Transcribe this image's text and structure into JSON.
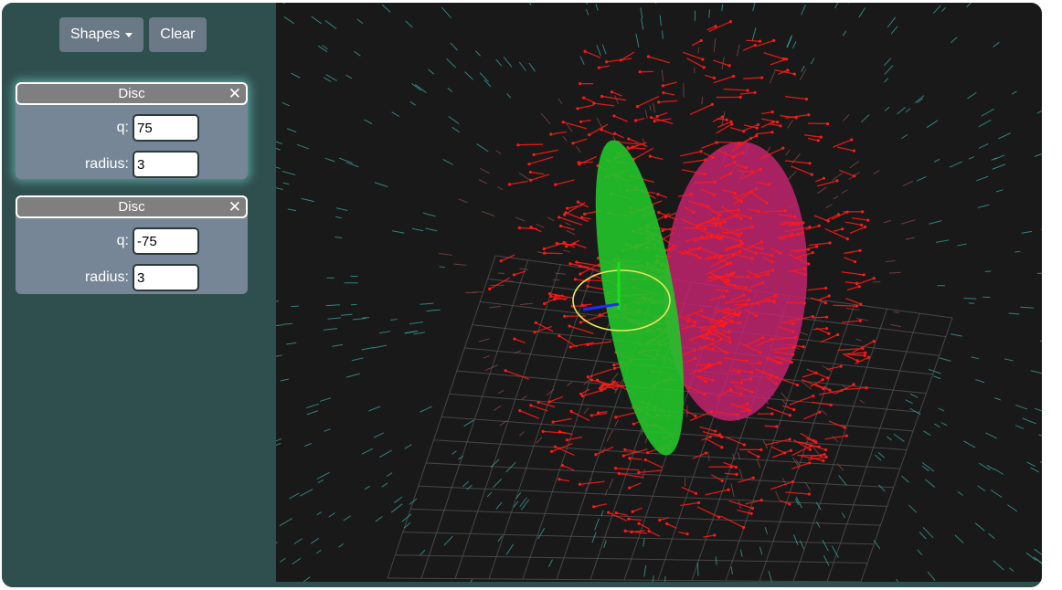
{
  "toolbar": {
    "shapes_label": "Shapes",
    "clear_label": "Clear"
  },
  "shapes": [
    {
      "title": "Disc",
      "close": "✕",
      "q_label": "q:",
      "q_value": "75",
      "radius_label": "radius:",
      "radius_value": "3"
    },
    {
      "title": "Disc",
      "close": "✕",
      "q_label": "q:",
      "q_value": "-75",
      "radius_label": "radius:",
      "radius_value": "3"
    }
  ],
  "scene": {
    "background": "#191919",
    "grid_color": "#5a5a5a",
    "disc_positive_color": "#22c42a",
    "disc_negative_color": "#c2256e",
    "field_near_color": "#ff1a1a",
    "field_far_color": "#3aa6a0",
    "gizmo_ring_color": "#e8e85a",
    "gizmo_x_color": "#1f2cff",
    "gizmo_y_color": "#18e218"
  }
}
